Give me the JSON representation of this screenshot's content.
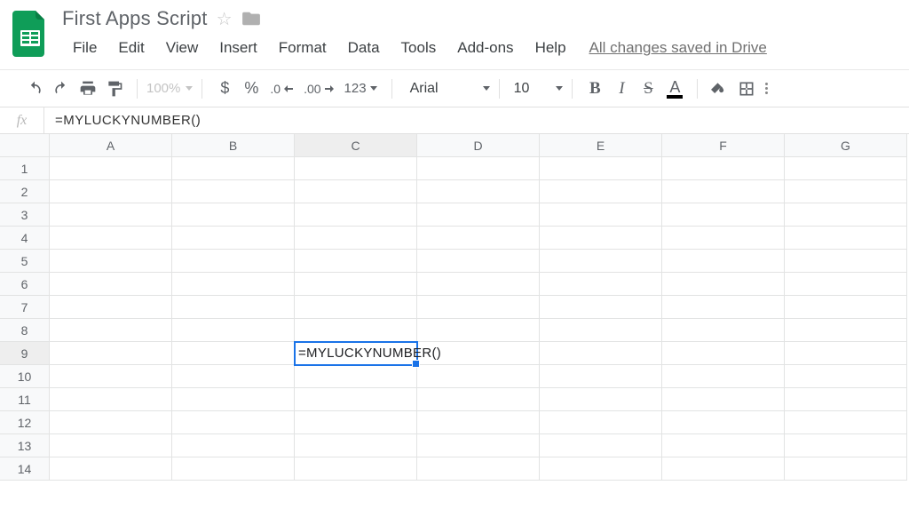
{
  "doc": {
    "title": "First Apps Script",
    "save_status": "All changes saved in Drive"
  },
  "menus": [
    "File",
    "Edit",
    "View",
    "Insert",
    "Format",
    "Data",
    "Tools",
    "Add-ons",
    "Help"
  ],
  "toolbar": {
    "zoom": "100%",
    "currency": "$",
    "percent": "%",
    "dec_less": ".0",
    "dec_more": ".00",
    "num_format": "123",
    "font": "Arial",
    "font_size": "10"
  },
  "formula_bar": {
    "fx": "fx",
    "value": "=MYLUCKYNUMBER()"
  },
  "grid": {
    "columns": [
      "A",
      "B",
      "C",
      "D",
      "E",
      "F",
      "G"
    ],
    "rows": [
      "1",
      "2",
      "3",
      "4",
      "5",
      "6",
      "7",
      "8",
      "9",
      "10",
      "11",
      "12",
      "13",
      "14"
    ],
    "active_col_index": 2,
    "active_row_index": 8,
    "active_cell_text": "=MYLUCKYNUMBER()"
  }
}
